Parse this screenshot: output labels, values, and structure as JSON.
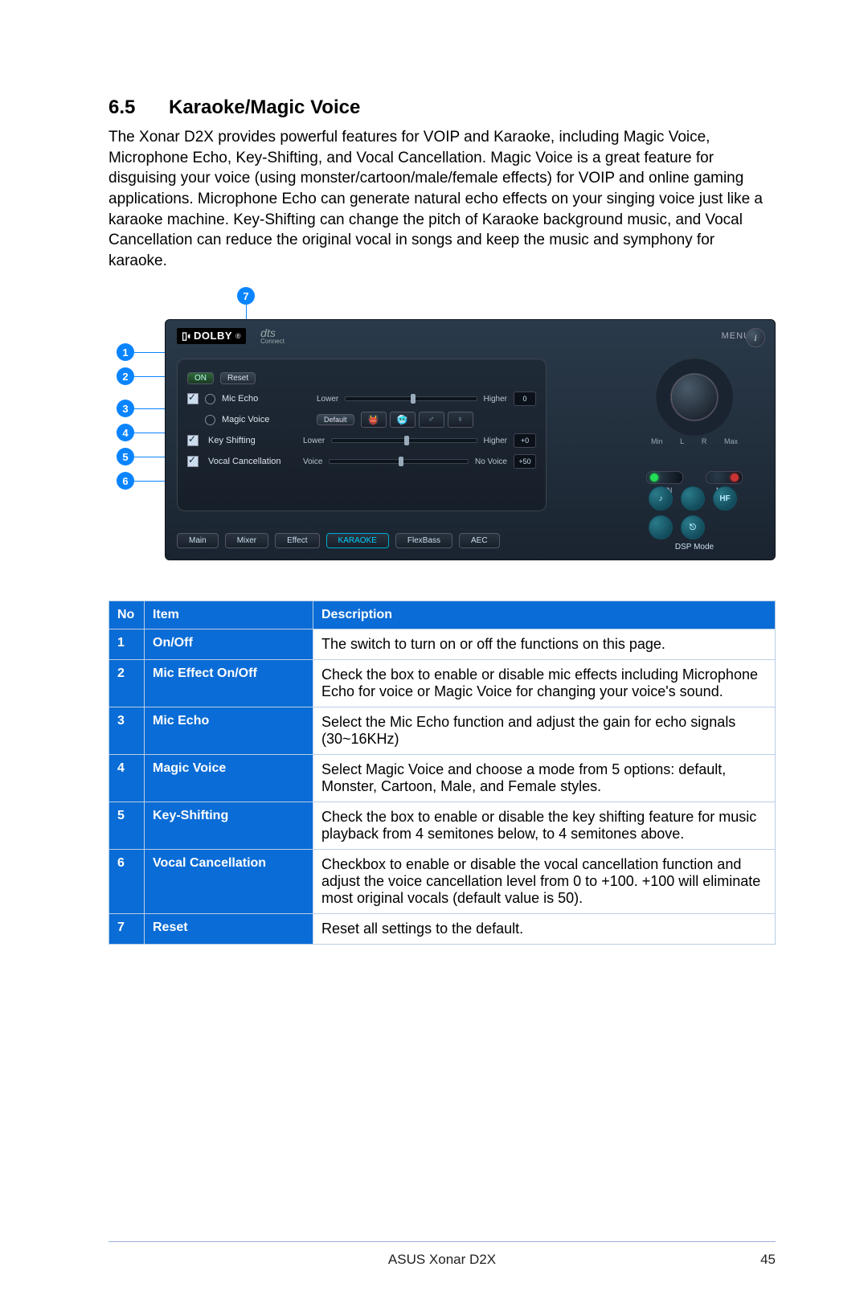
{
  "section": {
    "number": "6.5",
    "title": "Karaoke/Magic Voice"
  },
  "paragraph": "The Xonar D2X provides powerful features for VOIP and Karaoke, including Magic Voice, Microphone Echo, Key-Shifting, and Vocal Cancellation. Magic Voice is a great feature for disguising your voice (using monster/cartoon/male/female effects) for VOIP and online gaming applications. Microphone Echo can generate natural echo effects on your singing voice just like a karaoke machine. Key-Shifting can change the pitch of Karaoke background music, and Vocal Cancellation can reduce the original vocal in songs and keep the music and symphony for karaoke.",
  "callouts": [
    "1",
    "2",
    "3",
    "4",
    "5",
    "6",
    "7"
  ],
  "app": {
    "brand_dolby_dd": "▯◖",
    "brand_dolby": "DOLBY",
    "brand_dolby_reg": "®",
    "brand_dts": "dts",
    "brand_dts_sub": "Connect",
    "menu_label": "MENU",
    "info_label": "i",
    "on_label": "ON",
    "reset_label": "Reset",
    "micecho_label": "Mic Echo",
    "lower_label": "Lower",
    "higher_label": "Higher",
    "micecho_value": "0",
    "magicvoice_label": "Magic Voice",
    "mv_default": "Default",
    "mv_icons": [
      "👹",
      "🥶",
      "♂",
      "♀"
    ],
    "keyshift_label": "Key Shifting",
    "keyshift_value": "+0",
    "vcancel_label": "Vocal Cancellation",
    "voice_label": "Voice",
    "novoice_label": "No Voice",
    "vcancel_value": "+50",
    "tabs": [
      "Main",
      "Mixer",
      "Effect",
      "KARAOKE",
      "FlexBass",
      "AEC"
    ],
    "active_tab_index": 3,
    "knob_min": "Min",
    "knob_max": "Max",
    "knob_l": "L",
    "knob_r": "R",
    "svn_label": "SVN",
    "mute_label": "Mute",
    "dsp_buttons": [
      "♪",
      "",
      "HF",
      "",
      "⎋",
      ""
    ],
    "dsp_label": "DSP Mode"
  },
  "table": {
    "headers": [
      "No",
      "Item",
      "Description"
    ],
    "rows": [
      {
        "no": "1",
        "item": "On/Off",
        "desc": "The switch to turn on or off the functions on this page."
      },
      {
        "no": "2",
        "item": "Mic Effect On/Off",
        "desc": "Check the box to enable or disable mic effects including Microphone Echo for voice or Magic Voice for changing your voice's sound."
      },
      {
        "no": "3",
        "item": "Mic Echo",
        "desc": "Select the Mic Echo function and adjust the gain for echo signals (30~16KHz)"
      },
      {
        "no": "4",
        "item": "Magic Voice",
        "desc": "Select Magic Voice and choose a mode from 5 options: default, Monster, Cartoon, Male, and Female styles."
      },
      {
        "no": "5",
        "item": "Key-Shifting",
        "desc": "Check the box to enable or disable the key shifting feature for music playback from 4 semitones below, to 4 semitones above."
      },
      {
        "no": "6",
        "item": "Vocal Cancellation",
        "desc": "Checkbox to enable or disable the vocal cancellation function and adjust the voice cancellation level from 0 to +100. +100 will eliminate most original vocals (default value is 50)."
      },
      {
        "no": "7",
        "item": "Reset",
        "desc": "Reset all settings to the default."
      }
    ]
  },
  "footer": {
    "product": "ASUS Xonar D2X",
    "page": "45"
  }
}
